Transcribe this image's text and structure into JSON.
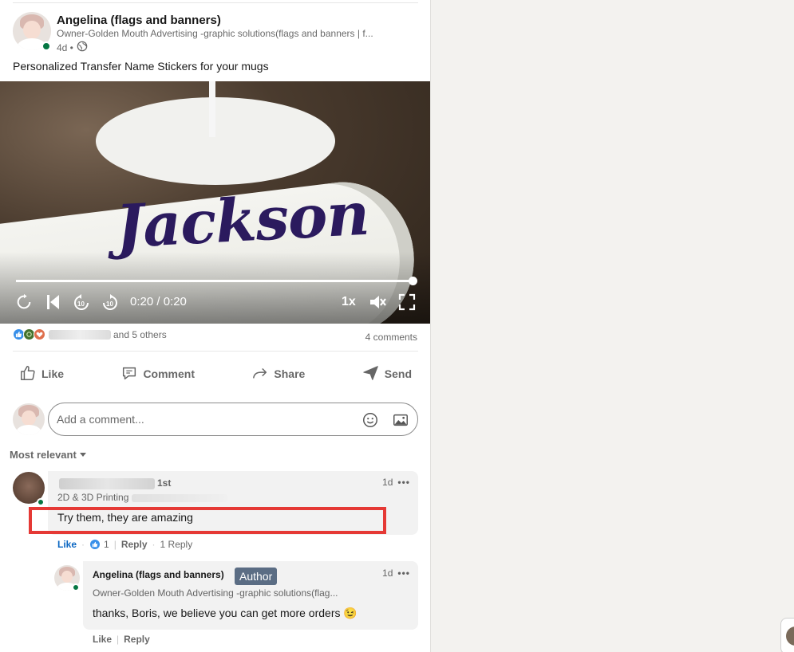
{
  "post": {
    "author": {
      "name": "Angelina (flags and banners)",
      "headline": "Owner-Golden Mouth Advertising -graphic solutions(flags and banners | f...",
      "time": "4d •"
    },
    "text": "Personalized Transfer Name Stickers for your mugs",
    "video": {
      "caption_on_mug": "Jackson",
      "time": "0:20 / 0:20",
      "speed": "1x",
      "progress": 1.0
    },
    "social": {
      "reactions_text": "and 5 others",
      "comments_count": "4 comments"
    },
    "actions": {
      "like": "Like",
      "comment": "Comment",
      "share": "Share",
      "send": "Send"
    },
    "comment_input": {
      "placeholder": "Add a comment..."
    },
    "sort_label": "Most relevant"
  },
  "comments": [
    {
      "degree": "1st",
      "headline": "2D & 3D Printing",
      "time": "1d",
      "text": "Try them, they are amazing",
      "like_label": "Like",
      "like_count": "1",
      "reply_label": "Reply",
      "replies_label": "1 Reply",
      "reply": {
        "name": "Angelina (flags and banners)",
        "badge": "Author",
        "headline": "Owner-Golden Mouth Advertising -graphic solutions(flag...",
        "time": "1d",
        "text": "thanks, Boris, we believe you can get more orders 😉",
        "like_label": "Like",
        "reply_label": "Reply"
      }
    }
  ],
  "colors": {
    "accent": "#0a66c2",
    "online": "#057642",
    "highlight": "#e53935",
    "author_badge": "#5b6d84",
    "mug_text": "#2b1a5e"
  }
}
